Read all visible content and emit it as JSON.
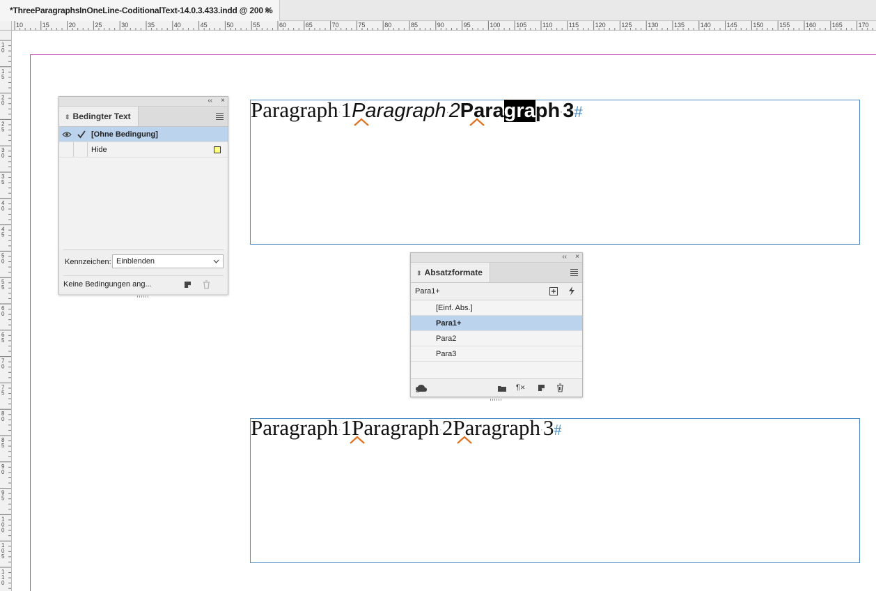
{
  "document_tab": {
    "title": "*ThreeParagraphsInOneLine-CoditionalText-14.0.3.433.indd @ 200 %",
    "close_glyph": "×"
  },
  "ruler_h_labels": [
    "10",
    "15",
    "20",
    "25",
    "30",
    "35",
    "40",
    "45",
    "50",
    "55",
    "60",
    "65",
    "70",
    "75",
    "80",
    "85",
    "90",
    "95",
    "100",
    "105",
    "110",
    "115",
    "120",
    "125",
    "130",
    "135",
    "140",
    "145",
    "150",
    "155",
    "160",
    "165",
    "170"
  ],
  "ruler_v_labels": [
    "10",
    "15",
    "20",
    "25",
    "30",
    "35",
    "40",
    "45",
    "50",
    "55",
    "60",
    "65",
    "70",
    "75",
    "80",
    "85",
    "90",
    "95",
    "100",
    "105",
    "110"
  ],
  "frame_top": {
    "p1": "Paragraph",
    "p1_num": "1",
    "p2": "Paragraph",
    "p2_num": "2",
    "p3_a": "Para",
    "p3_sel": "gra",
    "p3_b": "ph",
    "p3_num": "3",
    "dot": "·",
    "end_mark": "#"
  },
  "frame_bottom": {
    "p1": "Paragraph",
    "p1_num": "1",
    "p2": "Paragraph",
    "p2_num": "2",
    "p3": "Paragraph",
    "p3_num": "3",
    "dot": "·",
    "end_mark": "#"
  },
  "conditional_panel": {
    "collapse_glyph": "‹‹",
    "close_glyph": "×",
    "tab_label": "Bedingter Text",
    "tab_arrows": "⌃⌄",
    "rows": [
      {
        "label": "[Ohne Bedingung]",
        "visible": true,
        "checked": true,
        "selected": true,
        "swatch": ""
      },
      {
        "label": "Hide",
        "visible": false,
        "checked": false,
        "selected": false,
        "swatch": "#ffff80"
      }
    ],
    "indicator_label": "Kennzeichen:",
    "indicator_value": "Einblenden",
    "footer_text": "Keine Bedingungen ang..."
  },
  "paragraph_panel": {
    "collapse_glyph": "‹‹",
    "close_glyph": "×",
    "tab_label": "Absatzformate",
    "current_style": "Para1+",
    "styles": [
      {
        "label": "[Einf. Abs.]",
        "selected": false
      },
      {
        "label": "Para1+",
        "selected": true
      },
      {
        "label": "Para2",
        "selected": false
      },
      {
        "label": "Para3",
        "selected": false
      }
    ]
  },
  "colors": {
    "selection": "#bcd3ee",
    "frame_border": "#4a8cc4",
    "page_margin": "#c040c0",
    "caret": "#e0701e",
    "swatch_yellow": "#ffff80"
  }
}
